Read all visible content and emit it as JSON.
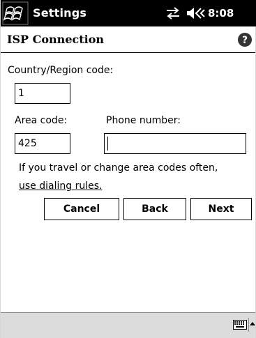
{
  "titlebar": {
    "app_title": "Settings",
    "clock": "8:08",
    "icons": {
      "start": "windows-flag-icon",
      "connectivity": "connectivity-icon",
      "volume": "speaker-icon"
    }
  },
  "header": {
    "title": "ISP Connection",
    "help_icon": "help-icon"
  },
  "form": {
    "country_label": "Country/Region code:",
    "country_value": "1",
    "area_label": "Area code:",
    "area_value": "425",
    "phone_label": "Phone number:",
    "phone_value": ""
  },
  "info": {
    "text": "If you travel or change area codes often,",
    "link": "use dialing rules."
  },
  "buttons": {
    "cancel": "Cancel",
    "back": "Back",
    "next": "Next"
  },
  "menubar": {
    "keyboard_icon": "keyboard-icon",
    "sip_arrow_icon": "up-arrow-icon"
  },
  "colors": {
    "titlebar_bg": "#000000",
    "menubar_bg": "#dcdcdc"
  }
}
